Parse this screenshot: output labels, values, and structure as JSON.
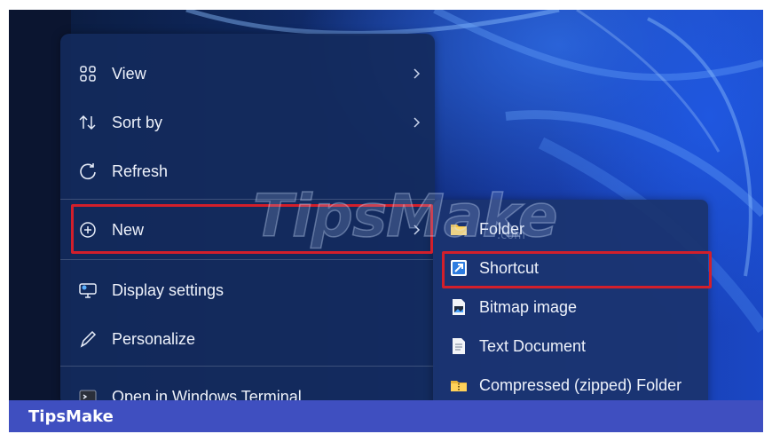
{
  "context_menu": {
    "items": [
      {
        "label": "View",
        "icon": "grid-view-icon",
        "has_submenu": true
      },
      {
        "label": "Sort by",
        "icon": "sort-arrows-icon",
        "has_submenu": true
      },
      {
        "label": "Refresh",
        "icon": "refresh-icon",
        "has_submenu": false
      },
      {
        "label": "New",
        "icon": "add-circle-icon",
        "has_submenu": true,
        "highlighted": true
      },
      {
        "label": "Display settings",
        "icon": "display-settings-icon",
        "has_submenu": false
      },
      {
        "label": "Personalize",
        "icon": "pen-icon",
        "has_submenu": false
      },
      {
        "label": "Open in Windows Terminal",
        "icon": "terminal-icon",
        "has_submenu": false
      }
    ]
  },
  "new_submenu": {
    "items": [
      {
        "label": "Folder",
        "icon": "folder-icon"
      },
      {
        "label": "Shortcut",
        "icon": "shortcut-icon",
        "highlighted": true
      },
      {
        "label": "Bitmap image",
        "icon": "bitmap-image-icon"
      },
      {
        "label": "Text Document",
        "icon": "text-document-icon"
      },
      {
        "label": "Compressed (zipped) Folder",
        "icon": "zip-folder-icon"
      }
    ]
  },
  "watermark": {
    "text": "TipsMake",
    "suffix": ".com"
  },
  "footer": {
    "brand": "TipsMake"
  },
  "colors": {
    "highlight_border": "#d21f2b",
    "footer_bg": "#3f4fc0",
    "menu_bg": "#142a5c"
  }
}
